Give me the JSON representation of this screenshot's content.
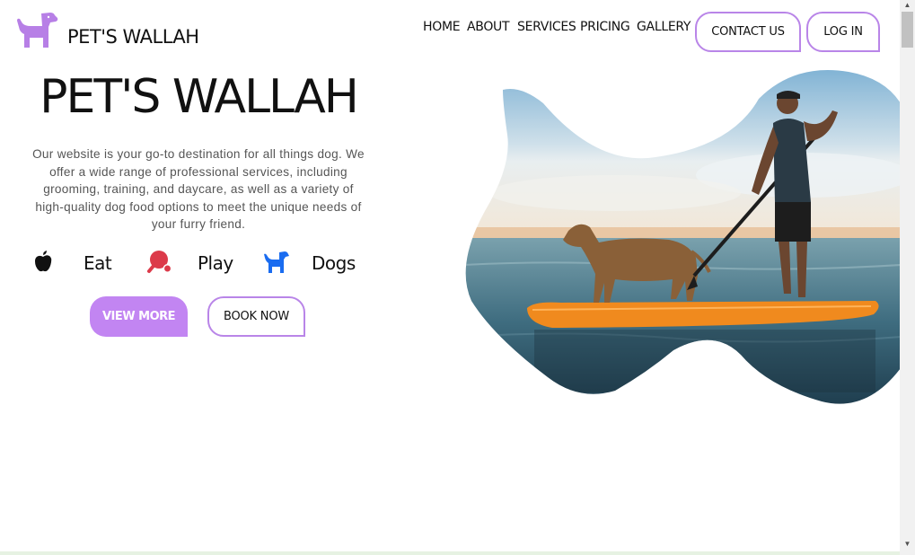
{
  "brand": {
    "name": "PET'S WALLAH",
    "accent": "#c285f2",
    "icon": "dog-icon"
  },
  "nav": {
    "links": [
      "HOME",
      "ABOUT",
      "SERVICES",
      "PRICING",
      "GALLERY"
    ],
    "contact_label": "CONTACT US",
    "login_label": "LOG IN"
  },
  "hero": {
    "title": "PET'S WALLAH",
    "description": "Our website is your go-to destination for all things dog. We offer a wide range of professional services, including grooming, training, and daycare, as well as a variety of high-quality dog food options to meet the unique needs of your furry friend.",
    "features": [
      {
        "label": "Eat",
        "icon": "apple-icon",
        "color": "#111111"
      },
      {
        "label": "Play",
        "icon": "ping-pong-icon",
        "color": "#dc3a4a"
      },
      {
        "label": "Dogs",
        "icon": "dog-icon",
        "color": "#1a6cf0"
      }
    ],
    "view_more_label": "VIEW MORE",
    "book_now_label": "BOOK NOW"
  },
  "image": {
    "subject": "man-paddleboarding-with-dog-photo"
  }
}
